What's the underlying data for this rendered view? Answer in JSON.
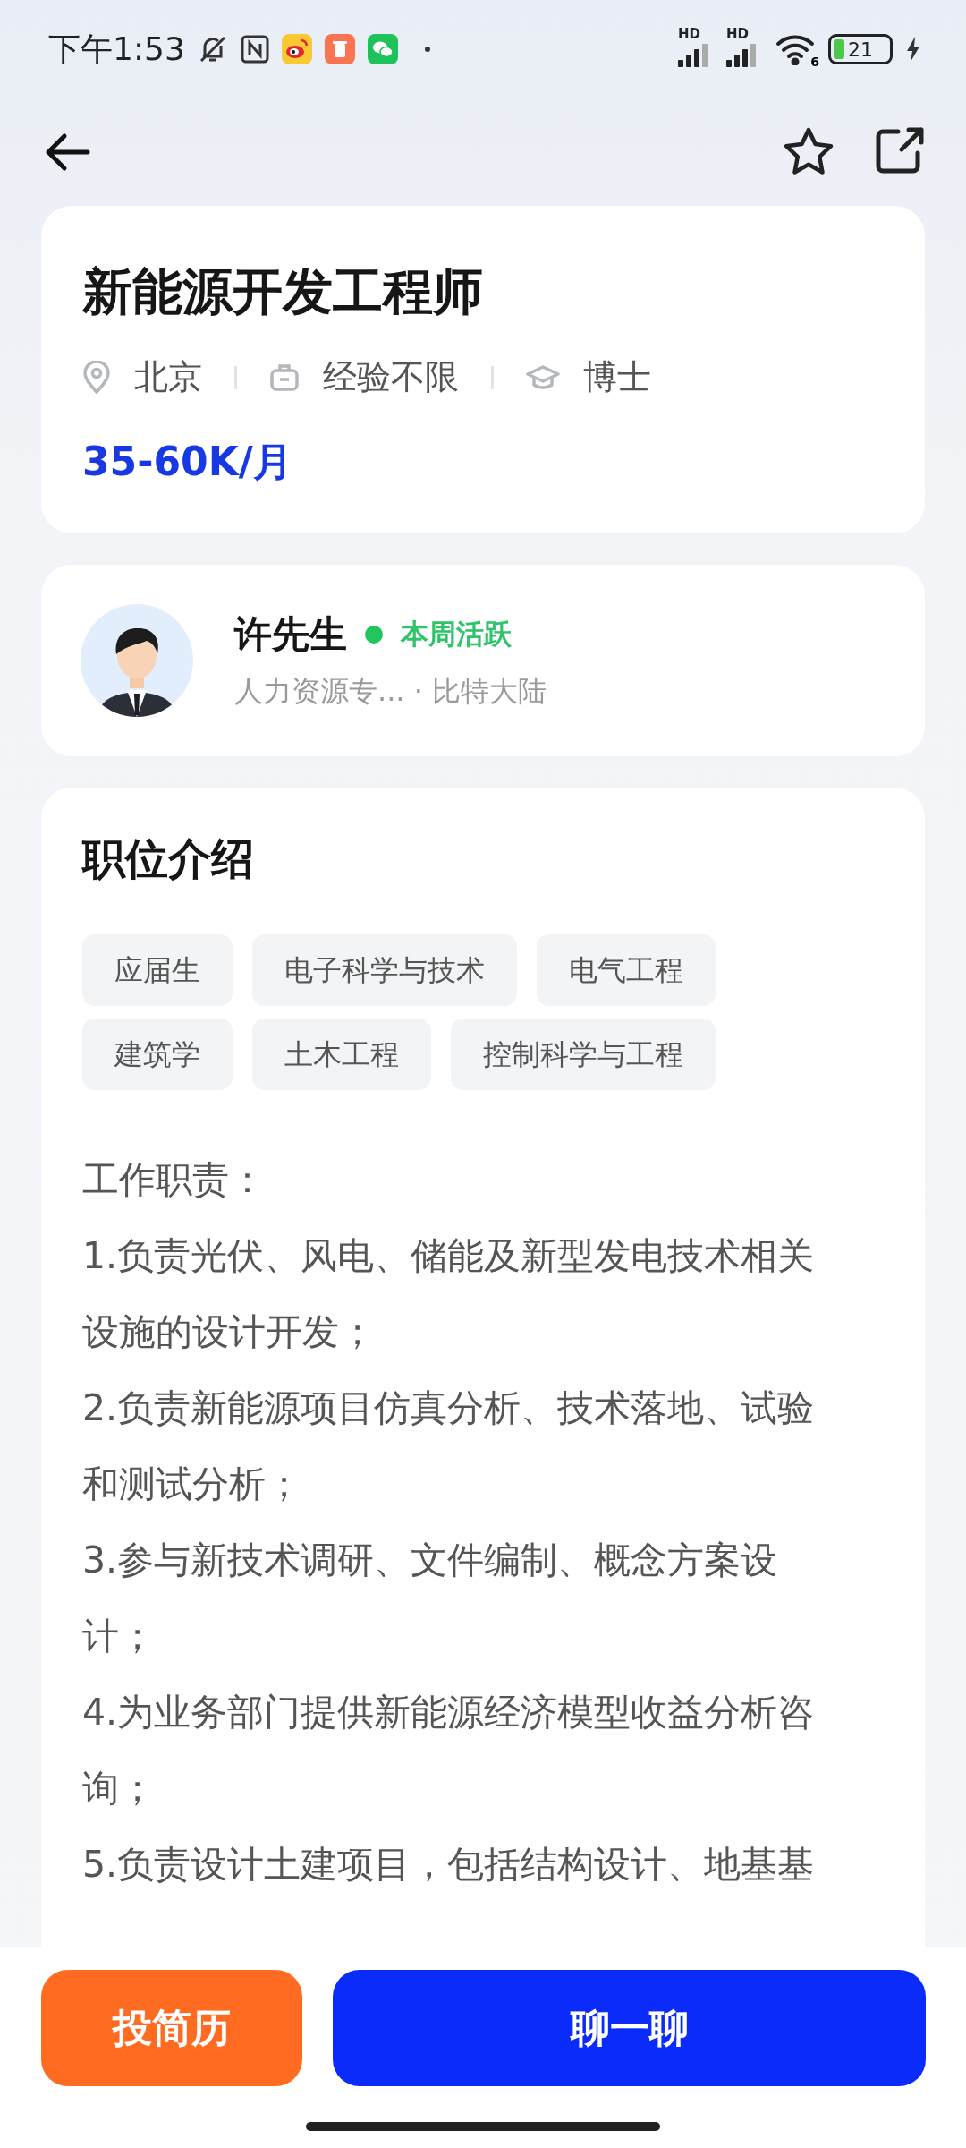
{
  "status_bar": {
    "time": "下午1:53",
    "sim_labels": [
      "HD",
      "HD"
    ],
    "wifi_label": "6",
    "battery": "21",
    "charging": true
  },
  "nav": {
    "favorited": false
  },
  "job": {
    "title": "新能源开发工程师",
    "meta": [
      {
        "kind": "location",
        "text": "北京"
      },
      {
        "kind": "experience",
        "text": "经验不限"
      },
      {
        "kind": "education",
        "text": "博士"
      }
    ],
    "salary": "35-60K/月"
  },
  "recruiter": {
    "name": "许先生",
    "active": true,
    "active_label": "本周活跃",
    "subtitle": "人力资源专... · 比特大陆"
  },
  "intro": {
    "title": "职位介绍",
    "tags": [
      "应届生",
      "电子科学与技术",
      "电气工程",
      "建筑学",
      "土木工程",
      "控制科学与工程"
    ],
    "description": [
      "工作职责：",
      "1.负责光伏、风电、储能及新型发电技术相关设施的设计开发；",
      "2.负责新能源项目仿真分析、技术落地、试验和测试分析；",
      "3.参与新技术调研、文件编制、概念方案设计；",
      "4.为业务部门提供新能源经济模型收益分析咨询；",
      "5.负责设计土建项目，包括结构设计、地基基"
    ]
  },
  "actions": [
    {
      "kind": "secondary",
      "label": "投简历"
    },
    {
      "kind": "primary",
      "label": "聊一聊"
    }
  ]
}
